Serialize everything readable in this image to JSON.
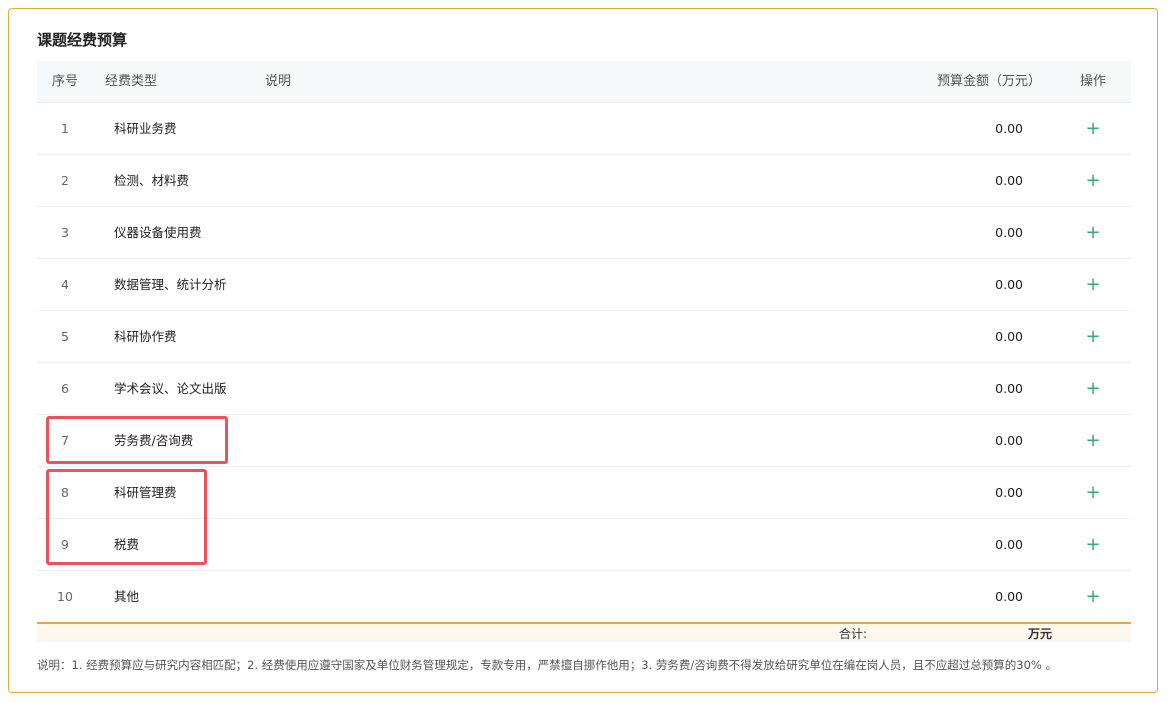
{
  "section": {
    "title": "课题经费预算"
  },
  "table": {
    "headers": {
      "no": "序号",
      "type": "经费类型",
      "desc": "说明",
      "amount": "预算金额（万元）",
      "op": "操作"
    },
    "rows": [
      {
        "no": "1",
        "type": "科研业务费",
        "amount": "0.00"
      },
      {
        "no": "2",
        "type": "检测、材料费",
        "amount": "0.00"
      },
      {
        "no": "3",
        "type": "仪器设备使用费",
        "amount": "0.00"
      },
      {
        "no": "4",
        "type": "数据管理、统计分析",
        "amount": "0.00"
      },
      {
        "no": "5",
        "type": "科研协作费",
        "amount": "0.00"
      },
      {
        "no": "6",
        "type": "学术会议、论文出版",
        "amount": "0.00"
      },
      {
        "no": "7",
        "type": "劳务费/咨询费",
        "amount": "0.00"
      },
      {
        "no": "8",
        "type": "科研管理费",
        "amount": "0.00"
      },
      {
        "no": "9",
        "type": "税费",
        "amount": "0.00"
      },
      {
        "no": "10",
        "type": "其他",
        "amount": "0.00"
      }
    ],
    "add_symbol": "+"
  },
  "total": {
    "label": "合计:",
    "unit": "万元"
  },
  "note": "说明：1. 经费预算应与研究内容相匹配；2. 经费使用应遵守国家及单位财务管理规定，专款专用，严禁擅自挪作他用；3. 劳务费/咨询费不得发放给研究单位在编在岗人员，且不应超过总预算的30% 。",
  "colors": {
    "accent": "#e5a93a",
    "add": "#3aa96a",
    "highlight": "#e9535a"
  }
}
